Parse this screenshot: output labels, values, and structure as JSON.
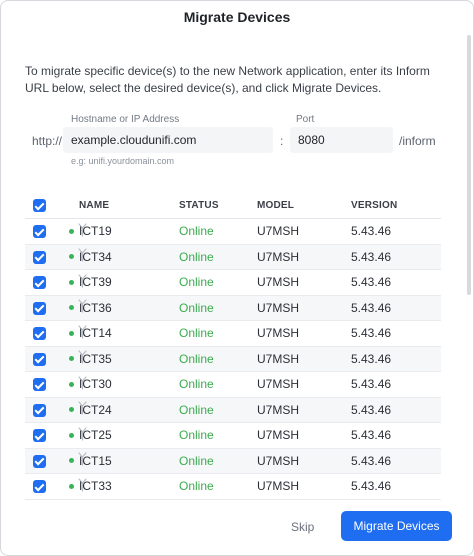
{
  "dialog": {
    "title": "Migrate Devices",
    "intro": "To migrate specific device(s) to the new Network application, enter its Inform URL below, select the desired device(s), and click Migrate Devices."
  },
  "form": {
    "hostname_label": "Hostname or IP Address",
    "port_label": "Port",
    "prefix": "http://",
    "hostname_value": "example.cloudunifi.com",
    "colon": ":",
    "port_value": "8080",
    "suffix": "/inform",
    "hint": "e.g: unifi.yourdomain.com"
  },
  "table": {
    "headers": {
      "name": "NAME",
      "status": "STATUS",
      "model": "MODEL",
      "version": "VERSION"
    },
    "rows": [
      {
        "name": "ICT19",
        "status": "Online",
        "model": "U7MSH",
        "version": "5.43.46"
      },
      {
        "name": "ICT34",
        "status": "Online",
        "model": "U7MSH",
        "version": "5.43.46"
      },
      {
        "name": "ICT39",
        "status": "Online",
        "model": "U7MSH",
        "version": "5.43.46"
      },
      {
        "name": "ICT36",
        "status": "Online",
        "model": "U7MSH",
        "version": "5.43.46"
      },
      {
        "name": "ICT14",
        "status": "Online",
        "model": "U7MSH",
        "version": "5.43.46"
      },
      {
        "name": "ICT35",
        "status": "Online",
        "model": "U7MSH",
        "version": "5.43.46"
      },
      {
        "name": "ICT30",
        "status": "Online",
        "model": "U7MSH",
        "version": "5.43.46"
      },
      {
        "name": "ICT24",
        "status": "Online",
        "model": "U7MSH",
        "version": "5.43.46"
      },
      {
        "name": "ICT25",
        "status": "Online",
        "model": "U7MSH",
        "version": "5.43.46"
      },
      {
        "name": "ICT15",
        "status": "Online",
        "model": "U7MSH",
        "version": "5.43.46"
      },
      {
        "name": "ICT33",
        "status": "Online",
        "model": "U7MSH",
        "version": "5.43.46"
      }
    ]
  },
  "footer": {
    "skip_label": "Skip",
    "migrate_label": "Migrate Devices"
  },
  "colors": {
    "accent": "#1f6ef2",
    "online": "#3bab4f",
    "status_dot": "#38b35a"
  },
  "icons": {
    "row_device": "access-point-antenna-icon",
    "row_status": "status-dot-icon",
    "checkbox": "checkmark-icon"
  }
}
